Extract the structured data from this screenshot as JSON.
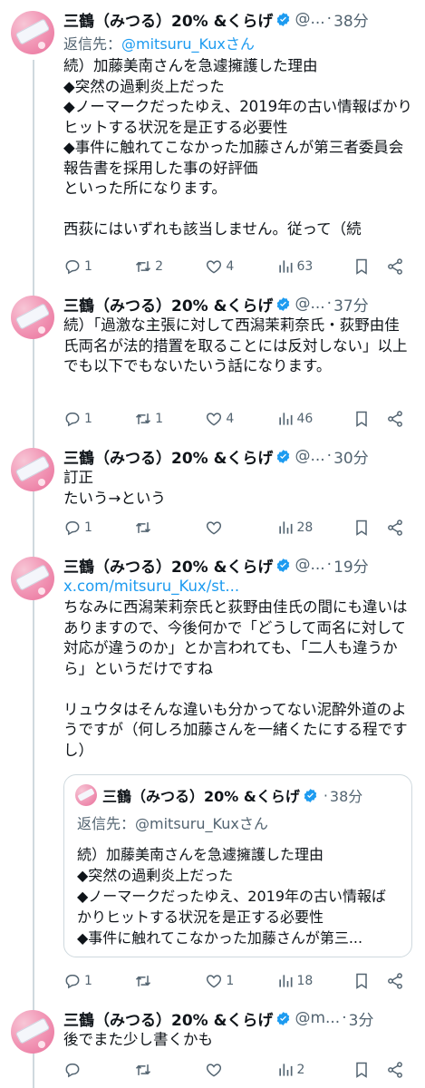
{
  "author": {
    "name": "三鶴（みつる）20% &くらげ",
    "more_label": "···"
  },
  "tweets": [
    {
      "handle": "@...",
      "time": "38分",
      "reply_prefix": "返信先：",
      "reply_to": "@mitsuru_Kuxさん",
      "text": "続）加藤美南さんを急遽擁護した理由\n◆突然の過剰炎上だった\n◆ノーマークだったゆえ、2019年の古い情報ばかりヒットする状況を是正する必要性\n◆事件に触れてこなかった加藤さんが第三者委員会報告書を採用した事の好評価\nといった所になります。\n\n西荻にはいずれも該当しません。従って（続",
      "replies": "1",
      "retweets": "2",
      "likes": "4",
      "views": "63"
    },
    {
      "handle": "@...",
      "time": "37分",
      "text": "続）「過激な主張に対して西潟茉莉奈氏・荻野由佳氏両名が法的措置を取ることには反対しない」以上でも以下でもないたいう話になります。",
      "replies": "1",
      "retweets": "1",
      "likes": "4",
      "views": "46"
    },
    {
      "handle": "@...",
      "time": "30分",
      "text": "訂正\nたいう→という",
      "replies": "1",
      "retweets": "",
      "likes": "",
      "views": "28"
    },
    {
      "handle": "@...",
      "time": "19分",
      "link": "x.com/mitsuru_Kux/st...",
      "text": "ちなみに西潟茉莉奈氏と荻野由佳氏の間にも違いはありますので、今後何かで「どうして両名に対して対応が違うのか」とか言われても、「二人も違うから」というだけですね\n\nリュウタはそんな違いも分かってない泥酔外道のようですが（何しろ加藤さんを一緒くたにする程ですし）",
      "quote": {
        "name": "三鶴（みつる）20% &くらげ",
        "time": "38分",
        "reply_prefix": "返信先：",
        "reply_to": "@mitsuru_Kuxさん",
        "text": "続）加藤美南さんを急遽擁護した理由\n◆突然の過剰炎上だった\n◆ノーマークだったゆえ、2019年の古い情報ばかりヒットする状況を是正する必要性\n◆事件に触れてこなかった加藤さんが第三..."
      },
      "replies": "1",
      "retweets": "",
      "likes": "1",
      "views": "18"
    },
    {
      "handle": "@m...",
      "time": "3分",
      "text": "後でまた少し書くかも",
      "replies": "",
      "retweets": "",
      "likes": "",
      "views": "2"
    }
  ],
  "colors": {
    "accent": "#1d9bf0",
    "muted": "#536471",
    "line": "#cfd9de"
  },
  "icons": [
    "verified-badge-icon",
    "reply-icon",
    "retweet-icon",
    "like-icon",
    "views-icon",
    "bookmark-icon",
    "share-icon",
    "more-icon"
  ]
}
